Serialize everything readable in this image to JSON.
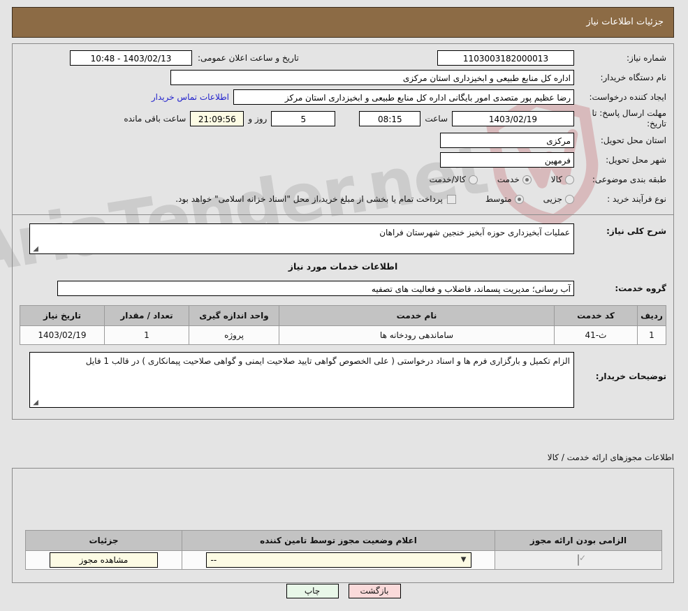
{
  "header": {
    "title": "جزئیات اطلاعات نیاز"
  },
  "top_form": {
    "need_number_label": "شماره نیاز:",
    "need_number_value": "1103003182000013",
    "announce_datetime_label": "تاریخ و ساعت اعلان عمومی:",
    "announce_datetime_value": "1403/02/13 - 10:48",
    "buyer_org_label": "نام دستگاه خریدار:",
    "buyer_org_value": "اداره کل منابع طبیعی و ابخیزداری استان مرکزی",
    "creator_label": "ایجاد کننده درخواست:",
    "creator_value": "رضا عظیم پور متصدی امور بایگانی اداره کل منابع طبیعی و ابخیزداری استان مرکز",
    "contact_link": "اطلاعات تماس خریدار",
    "deadline_label": "مهلت ارسال پاسخ: تا تاریخ:",
    "deadline_date": "1403/02/19",
    "hour_label": "ساعت",
    "deadline_time": "08:15",
    "days_remaining": "5",
    "days_label": "روز و",
    "countdown": "21:09:56",
    "remaining_label": "ساعت باقی مانده",
    "province_label": "استان محل تحویل:",
    "province_value": "مرکزی",
    "city_label": "شهر محل تحویل:",
    "city_value": "فرمهین",
    "category_label": "طبقه بندی موضوعی:",
    "category_options": [
      {
        "label": "کالا",
        "selected": false
      },
      {
        "label": "خدمت",
        "selected": true
      },
      {
        "label": "کالا/خدمت",
        "selected": false
      }
    ],
    "process_label": "نوع فرآیند خرید :",
    "process_options": [
      {
        "label": "جزیی",
        "selected": false
      },
      {
        "label": "متوسط",
        "selected": true
      }
    ],
    "treasury_checkbox_checked": false,
    "treasury_note": "پرداخت تمام یا بخشی از مبلغ خرید،از محل \"اسناد خزانه اسلامی\" خواهد بود."
  },
  "need_description": {
    "label": "شرح کلی نیاز:",
    "value": "عملیات آبخیزداری حوزه آبخیز خنجین شهرستان فراهان"
  },
  "services_heading": "اطلاعات خدمات مورد نیاز",
  "service_group": {
    "label": "گروه خدمت:",
    "value": "آب رسانی؛ مدیریت پسماند، فاضلاب و فعالیت های تصفیه"
  },
  "items_table": {
    "columns": [
      "ردیف",
      "کد خدمت",
      "نام خدمت",
      "واحد اندازه گیری",
      "تعداد / مقدار",
      "تاریخ نیاز"
    ],
    "rows": [
      [
        "1",
        "ث-41",
        "ساماندهی رودخانه ها",
        "پروژه",
        "1",
        "1403/02/19"
      ]
    ]
  },
  "buyer_notes": {
    "label": "توضیحات خریدار:",
    "value": "الزام تکمیل و بارگزاری فرم ها و اسناد درخواستی ( علی الخصوص گواهی تایید صلاحیت ایمنی و گواهی صلاحیت پیمانکاری ) در قالب 1 فایل"
  },
  "permits": {
    "section_label": "اطلاعات مجوزهای ارائه خدمت / کالا",
    "columns": [
      "الزامی بودن ارائه مجوز",
      "اعلام وضعیت مجوز توسط تامین کننده",
      "جزئیات"
    ],
    "rows": [
      {
        "required_checked": true,
        "status_value": "--",
        "details_button": "مشاهده مجوز"
      }
    ]
  },
  "footer_buttons": {
    "print": "چاپ",
    "back": "بازگشت"
  },
  "watermark": {
    "text": "AriaTender.net"
  },
  "colors": {
    "header_bg": "#8c6b45",
    "page_bg": "#e4e4e4",
    "link": "#2222cc",
    "print_btn": "#e8f7e8",
    "back_btn": "#fadada",
    "table_header": "#c3c3c3",
    "cream_field": "#fcfbe4"
  }
}
